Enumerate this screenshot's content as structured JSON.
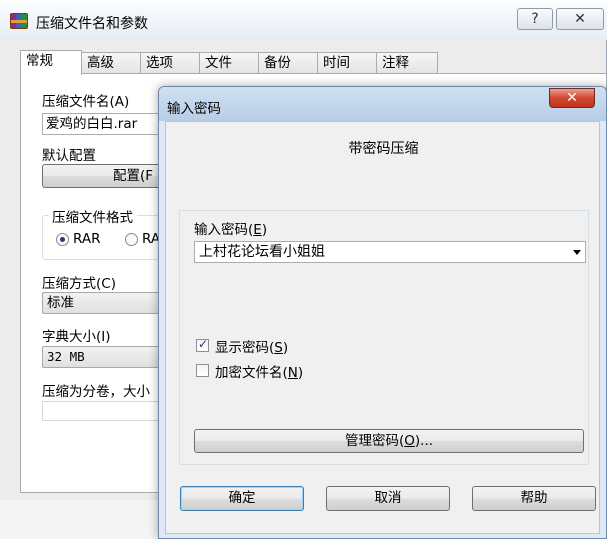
{
  "back_window": {
    "title": "压缩文件名和参数",
    "help_glyph": "?",
    "close_glyph": "✕",
    "tabs": [
      "常规",
      "高级",
      "选项",
      "文件",
      "备份",
      "时间",
      "注释"
    ],
    "archive_name_label": "压缩文件名(A)",
    "archive_name_value": "爱鸡的白白.rar",
    "default_profile_label": "默认配置",
    "profile_button": "配置(F",
    "format_group_label": "压缩文件格式",
    "format_option_rar": "RAR",
    "format_option_rar5": "RA",
    "method_label": "压缩方式(C)",
    "method_value": "标准",
    "dict_label": "字典大小(I)",
    "dict_value": "32 MB",
    "split_label": "压缩为分卷，大小"
  },
  "password_dialog": {
    "title": "输入密码",
    "close_glyph": "✕",
    "heading": "带密码压缩",
    "password_label": "输入密码",
    "password_label_key": "E",
    "password_value": "上村花论坛看小姐姐",
    "show_password_label": "显示密码",
    "show_password_key": "S",
    "show_password_checked": true,
    "encrypt_names_label": "加密文件名",
    "encrypt_names_key": "N",
    "encrypt_names_checked": false,
    "manage_button": "管理密码",
    "manage_key": "O",
    "ok_button": "确定",
    "cancel_button": "取消",
    "help_button": "帮助"
  },
  "icons": {
    "app": "winrar-icon",
    "dropdown": "chevron-down-icon",
    "checkbox_check": "checkmark-icon"
  }
}
